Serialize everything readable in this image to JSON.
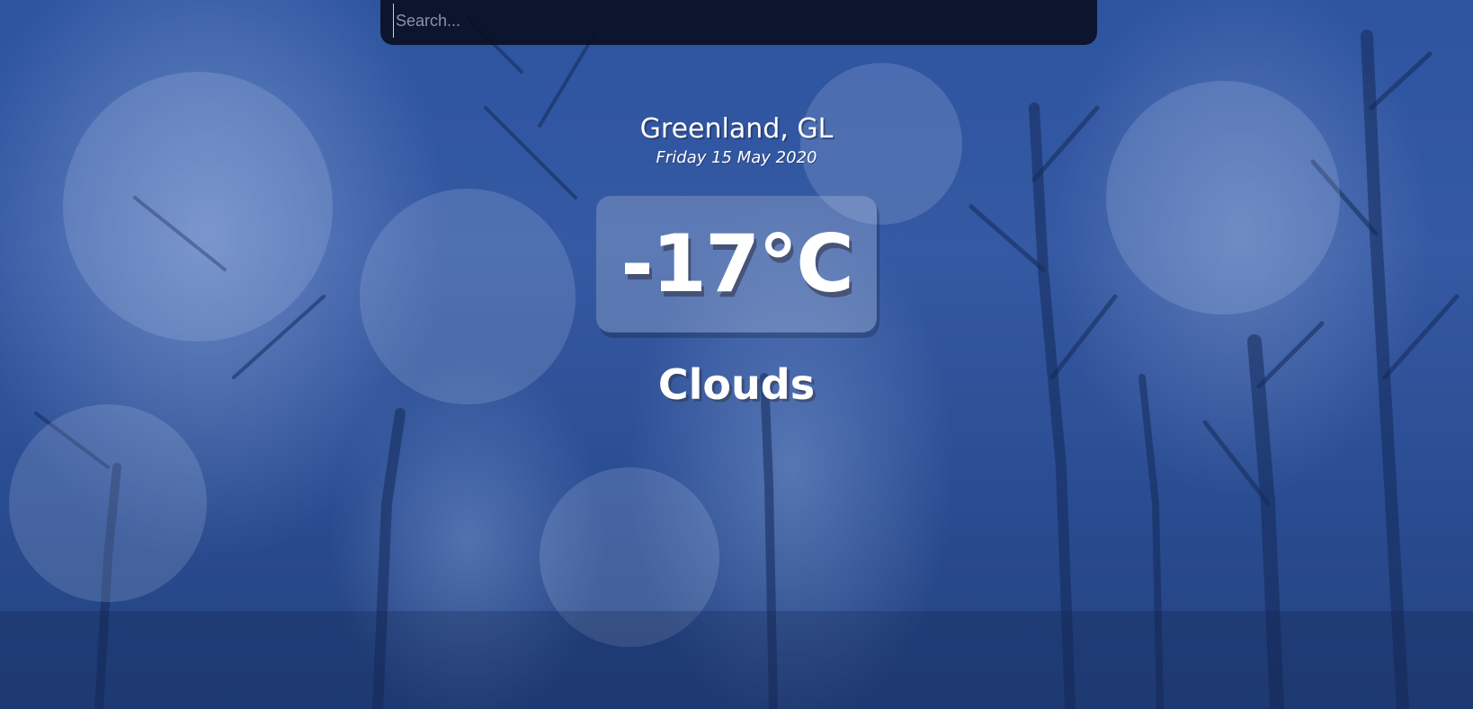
{
  "search": {
    "placeholder": "Search...",
    "value": ""
  },
  "location": {
    "name": "Greenland, GL",
    "date": "Friday 15 May 2020"
  },
  "weather": {
    "temperature": "-17°C",
    "condition": "Clouds"
  },
  "colors": {
    "background": "#2b4f92",
    "search_bar": "#080c1c",
    "text": "#ffffff"
  }
}
